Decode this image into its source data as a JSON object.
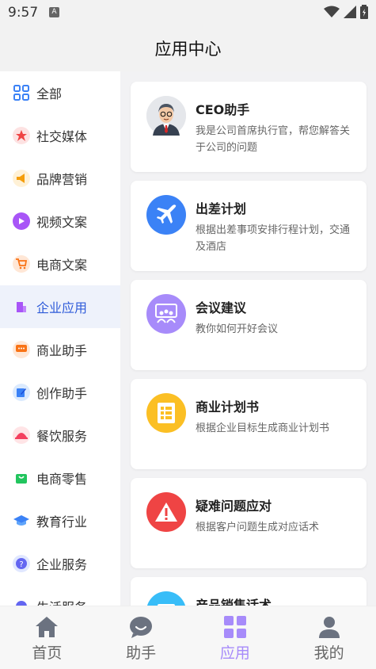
{
  "status": {
    "time": "9:57",
    "a_badge": "A"
  },
  "header": {
    "title": "应用中心"
  },
  "sidebar": {
    "items": [
      {
        "label": "全部",
        "icon": "grid-icon",
        "color": "#3b82f6"
      },
      {
        "label": "社交媒体",
        "icon": "star-icon",
        "color": "#ef4444"
      },
      {
        "label": "品牌营销",
        "icon": "megaphone-icon",
        "color": "#f59e0b"
      },
      {
        "label": "视频文案",
        "icon": "play-icon",
        "color": "#a855f7"
      },
      {
        "label": "电商文案",
        "icon": "cart-icon",
        "color": "#f97316"
      },
      {
        "label": "企业应用",
        "icon": "building-icon",
        "color": "#a855f7"
      },
      {
        "label": "商业助手",
        "icon": "chat-icon",
        "color": "#f97316"
      },
      {
        "label": "创作助手",
        "icon": "edit-icon",
        "color": "#3b82f6"
      },
      {
        "label": "餐饮服务",
        "icon": "dish-icon",
        "color": "#f43f5e"
      },
      {
        "label": "电商零售",
        "icon": "bag-icon",
        "color": "#22c55e"
      },
      {
        "label": "教育行业",
        "icon": "graduation-icon",
        "color": "#3b82f6"
      },
      {
        "label": "企业服务",
        "icon": "question-icon",
        "color": "#6366f1"
      },
      {
        "label": "生活服务",
        "icon": "life-icon",
        "color": "#6366f1"
      }
    ]
  },
  "cards": [
    {
      "title": "CEO助手",
      "desc": "我是公司首席执行官，帮您解答关于公司的问题",
      "icon": "ceo-avatar-icon",
      "color": "#e5e7eb"
    },
    {
      "title": "出差计划",
      "desc": "根据出差事项安排行程计划，交通及酒店",
      "icon": "airplane-icon",
      "color": "#3b82f6"
    },
    {
      "title": "会议建议",
      "desc": "教你如何开好会议",
      "icon": "meeting-icon",
      "color": "#a78bfa"
    },
    {
      "title": "商业计划书",
      "desc": "根据企业目标生成商业计划书",
      "icon": "document-icon",
      "color": "#fbbf24"
    },
    {
      "title": "疑难问题应对",
      "desc": "根据客户问题生成对应话术",
      "icon": "warning-icon",
      "color": "#ef4444"
    },
    {
      "title": "产品销售话术",
      "desc": "",
      "icon": "sales-icon",
      "color": "#38bdf8"
    }
  ],
  "tabbar": {
    "tabs": [
      {
        "label": "首页",
        "icon": "home-icon"
      },
      {
        "label": "助手",
        "icon": "assistant-icon"
      },
      {
        "label": "应用",
        "icon": "apps-icon"
      },
      {
        "label": "我的",
        "icon": "profile-icon"
      }
    ]
  }
}
